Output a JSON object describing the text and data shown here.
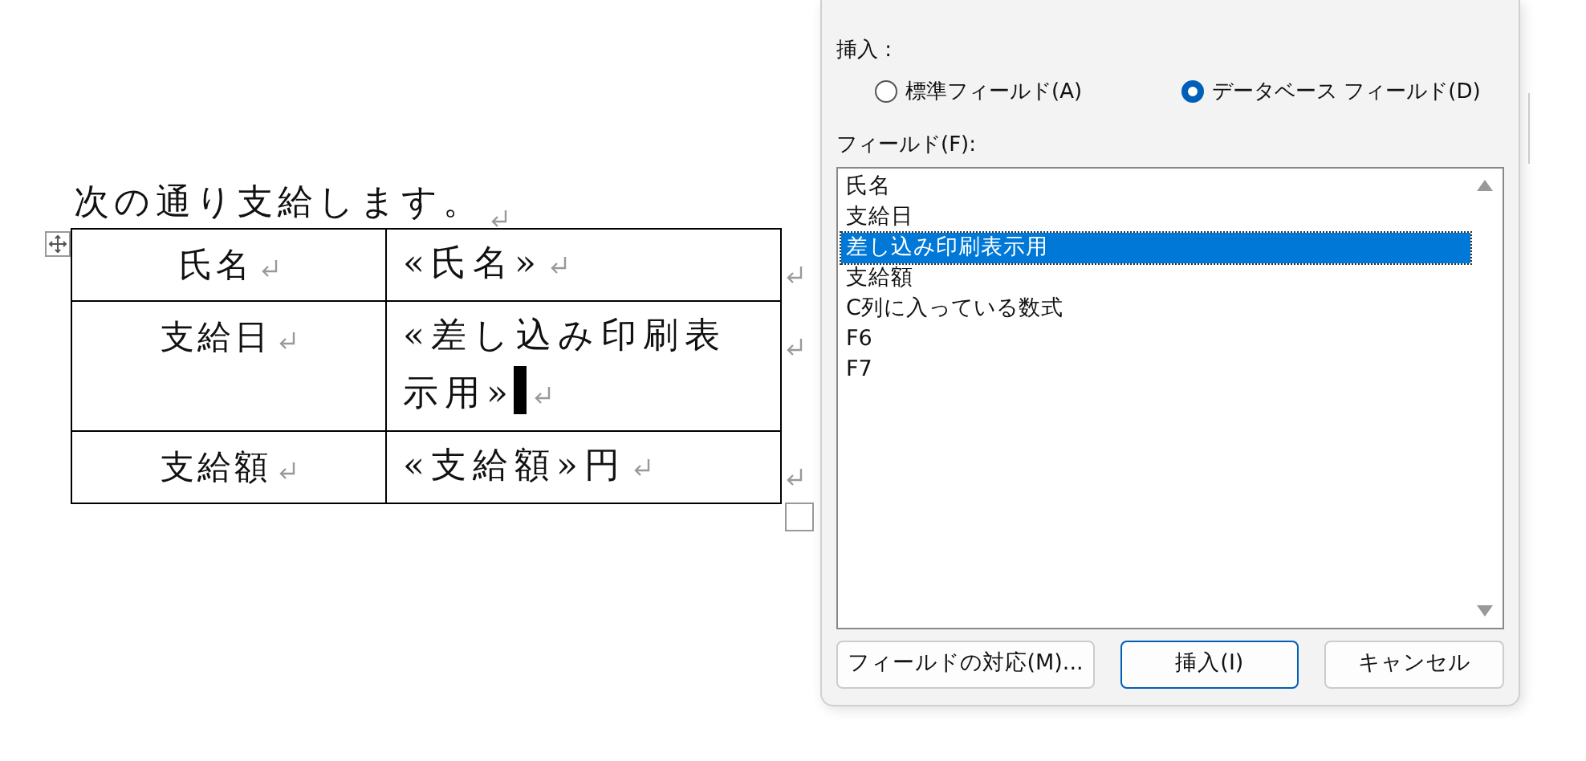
{
  "document": {
    "heading": "次の通り支給します。",
    "table": {
      "rows": [
        {
          "label": "氏名",
          "value_lines": [
            "«氏名»"
          ],
          "cursor": false
        },
        {
          "label": "支給日",
          "value_lines": [
            "«差し込み印刷表",
            "示用»"
          ],
          "cursor": true
        },
        {
          "label": "支給額",
          "value_lines": [
            "«支給額»円"
          ],
          "cursor": false
        }
      ]
    }
  },
  "dialog": {
    "insert_label": "挿入 :",
    "radios": [
      {
        "label": "標準フィールド(A)",
        "selected": false
      },
      {
        "label": "データベース フィールド(D)",
        "selected": true
      }
    ],
    "fields_label": "フィールド(F):",
    "fields": [
      {
        "label": "氏名",
        "selected": false
      },
      {
        "label": "支給日",
        "selected": false
      },
      {
        "label": "差し込み印刷表示用",
        "selected": true
      },
      {
        "label": "支給額",
        "selected": false
      },
      {
        "label": "C列に入っている数式",
        "selected": false
      },
      {
        "label": "F6",
        "selected": false
      },
      {
        "label": "F7",
        "selected": false
      }
    ],
    "buttons": [
      {
        "label": "フィールドの対応(M)...",
        "default": false
      },
      {
        "label": "挿入(I)",
        "default": true
      },
      {
        "label": "キャンセル",
        "default": false
      }
    ]
  }
}
